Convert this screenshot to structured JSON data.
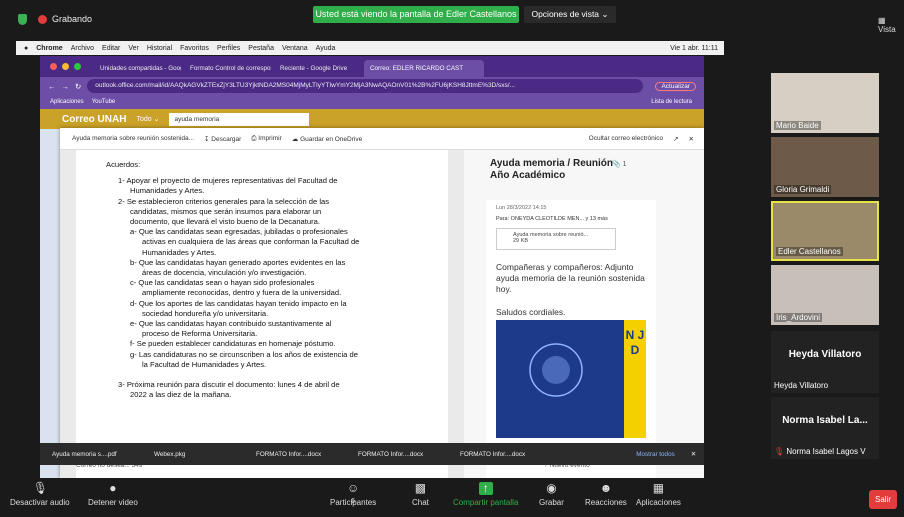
{
  "zoom": {
    "recording": "Grabando",
    "share_banner": "Usted está viendo la pantalla de Edler Castellanos",
    "view_options": "Opciones de vista ⌄",
    "gallery": "▦ Vista"
  },
  "macbar": {
    "items": [
      "Chrome",
      "Archivo",
      "Editar",
      "Ver",
      "Historial",
      "Favoritos",
      "Perfiles",
      "Pestaña",
      "Ventana",
      "Ayuda"
    ],
    "clock": "Vie 1 abr. 11:11"
  },
  "browser": {
    "tabs": [
      "Unidades compartidas - Goog",
      "Formato Control de correspon",
      "Reciente - Google Drive",
      "Correo: EDLER RICARDO CAST"
    ],
    "url": "outlook.office.com/mail/id/AAQkAGVkZTExZjY3LTU3YjktNDA2MS04MjMyLTIyYTIwYmY2MjA3NwAQAOnV01%2B%2FU6jKSH8JttmE%3D/sxs/...",
    "update": "Actualizar",
    "bookmarks": [
      "Aplicaciones",
      "YouTube"
    ],
    "reading_list": "Lista de lectura"
  },
  "owa": {
    "app": "Correo UNAH",
    "filter": "Todo ⌄",
    "search": "ayuda memoria"
  },
  "modal": {
    "filename": "Ayuda memoria sobre reunión sostenida...",
    "download": "Descargar",
    "print": "Imprimir",
    "save": "Guardar en OneDrive",
    "hide": "Ocultar correo electrónico",
    "doc_lines": [
      "Acuerdos:",
      "1- Apoyar el proyecto de mujeres representativas del Facultad de",
      "Humanidades y Artes.",
      "2- Se establecieron criterios generales para la selección de las",
      "candidatas, mismos que serán insumos para elaborar un",
      "documento, que llevará el visto bueno de la Decanatura.",
      "a- Que las candidatas sean egresadas, jubiladas o profesionales",
      "activas en cualquiera de las áreas que conforman la Facultad de",
      "Humanidades y Artes.",
      "b- Que las candidatas hayan generado aportes evidentes en las",
      "áreas de docencia, vinculación y/o investigación.",
      "c- Que las candidatas sean o hayan sido profesionales",
      "ampliamente reconocidas, dentro y fuera de la universidad.",
      "d- Que los aportes de las candidatas hayan tenido impacto en la",
      "sociedad hondureña y/o universitaria.",
      "e- Que las candidatas hayan contribuido sustantivamente al",
      "proceso de Reforma Universitaria.",
      "f- Se pueden establecer candidaturas en homenaje póstumo.",
      "g- Las candidaturas no se circunscriben a los años de existencia de",
      "la Facultad de Humanidades y Artes.",
      "",
      "3- Próxima reunión para discutir el documento: lunes 4 de abril de",
      "2022 a las diez de la mañana."
    ],
    "doc_status": "Correo no desea...   349",
    "side_title": "Ayuda memoria / Reunión Año Académico",
    "side_count": "1",
    "sender_date": "Lun 28/3/2022 14:15",
    "to": "Para: ONEYDA CLEOTILDE MEN...  y 13 más",
    "attachment": "Ayuda memoria sobre reunió...",
    "attachment_size": "29 KB",
    "body1": "Compañeras y compañeros: Adjunto ayuda memoria de la reunión sostenida hoy.",
    "body2": "Saludos cordiales.",
    "poster_letters": "N J D",
    "new_event": "+ Nuevo evento"
  },
  "downloads": [
    "Ayuda memoria s....pdf",
    "Webex.pkg",
    "FORMATO Infor....docx",
    "FORMATO Infor....docx",
    "FORMATO Infor....docx"
  ],
  "show_all": "Mostrar todos",
  "participants": [
    {
      "name": "Mario Baide"
    },
    {
      "name": "Gloria Grimaldi"
    },
    {
      "name": "Edler Castellanos"
    },
    {
      "name": "Iris_Ardovini"
    }
  ],
  "name_tiles": [
    {
      "big": "Heyda Villatoro",
      "small": "Heyda Villatoro"
    },
    {
      "big": "Norma Isabel La...",
      "small": "Norma Isabel Lagos V"
    }
  ],
  "toolbar": {
    "mute": "Desactivar audio",
    "video": "Detener video",
    "participants": "Participantes",
    "participants_count": "6",
    "chat": "Chat",
    "share": "Compartir pantalla",
    "record": "Grabar",
    "reactions": "Reacciones",
    "apps": "Aplicaciones",
    "leave": "Salir"
  },
  "colors": {
    "zoom_green": "#2fae4a",
    "chrome_purple": "#6c4ea6",
    "owa_gold": "#c9a227",
    "leave_red": "#e23c3c"
  }
}
